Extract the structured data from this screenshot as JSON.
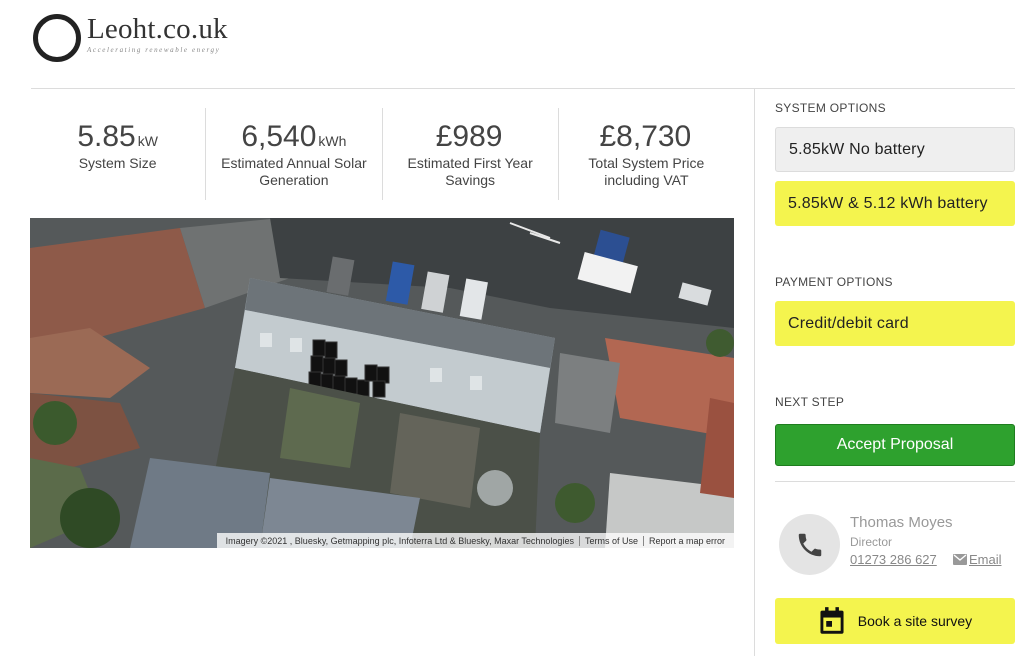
{
  "brand": {
    "name": "Leoht.co.uk",
    "tagline": "Accelerating renewable energy"
  },
  "stats": [
    {
      "value": "5.85",
      "unit": "kW",
      "label": "System Size"
    },
    {
      "value": "6,540",
      "unit": "kWh",
      "label": "Estimated Annual Solar Generation"
    },
    {
      "value": "£989",
      "unit": "",
      "label": "Estimated First Year Savings"
    },
    {
      "value": "£8,730",
      "unit": "",
      "label": "Total System Price including VAT"
    }
  ],
  "map": {
    "credit": "Imagery ©2021 , Bluesky, Getmapping plc, Infoterra Ltd & Bluesky, Maxar Technologies",
    "terms": "Terms of Use",
    "report": "Report a map error"
  },
  "system_options": {
    "label": "SYSTEM OPTIONS",
    "options": [
      "5.85kW No battery",
      "5.85kW & 5.12 kWh battery"
    ]
  },
  "payment_options": {
    "label": "PAYMENT OPTIONS",
    "options": [
      "Credit/debit card"
    ]
  },
  "next_step": {
    "label": "NEXT STEP",
    "button": "Accept Proposal"
  },
  "contact": {
    "name": "Thomas Moyes",
    "role": "Director",
    "phone": "01273 286 627",
    "email_label": "Email",
    "icons": [
      "phone-icon",
      "email-icon"
    ]
  },
  "survey": {
    "button": "Book a site survey",
    "icon": "calendar-icon"
  },
  "colors": {
    "accent_yellow": "#f4f44e",
    "accept_green": "#2ea12e",
    "option_grey": "#efefef"
  }
}
